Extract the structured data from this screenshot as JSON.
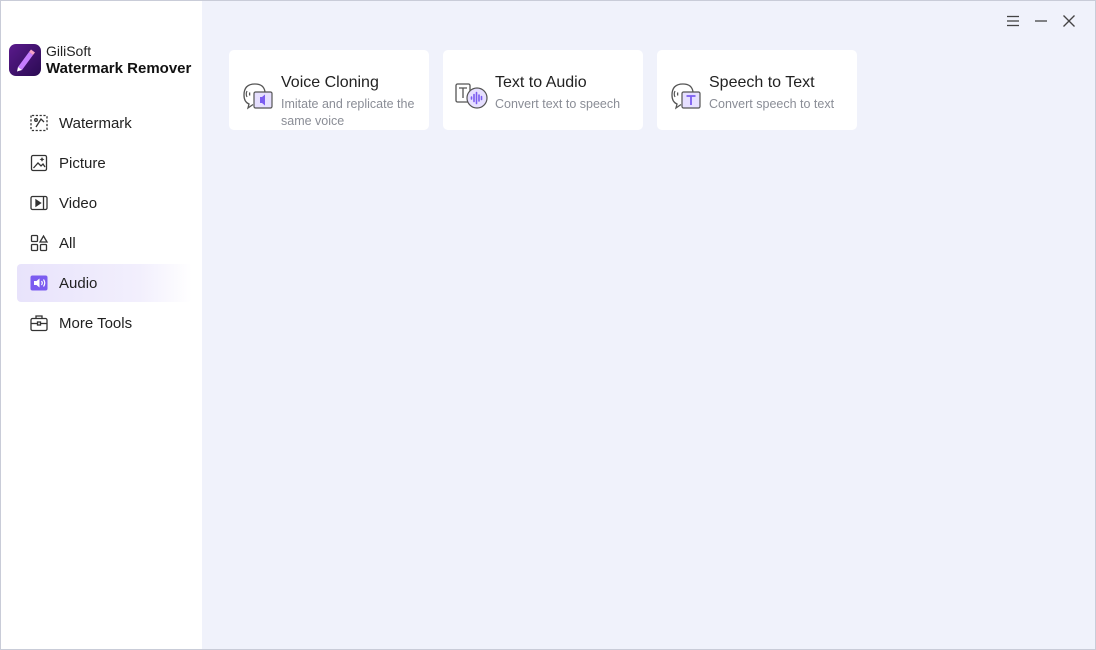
{
  "brand": {
    "line1": "GiliSoft",
    "line2": "Watermark Remover"
  },
  "sidebar": {
    "active": "Audio",
    "items": [
      {
        "label": "Watermark",
        "icon": "watermark-icon"
      },
      {
        "label": "Picture",
        "icon": "picture-icon"
      },
      {
        "label": "Video",
        "icon": "video-icon"
      },
      {
        "label": "All",
        "icon": "all-grid-icon"
      },
      {
        "label": "Audio",
        "icon": "audio-icon"
      },
      {
        "label": "More Tools",
        "icon": "toolbox-icon"
      }
    ]
  },
  "window_controls": {
    "menu": "menu-icon",
    "minimize": "minimize-icon",
    "close": "close-icon"
  },
  "cards": [
    {
      "title": "Voice Cloning",
      "desc": "Imitate and replicate the same voice",
      "icon": "voice-cloning-icon"
    },
    {
      "title": "Text to Audio",
      "desc": "Convert text to speech",
      "icon": "text-to-audio-icon"
    },
    {
      "title": "Speech to Text",
      "desc": "Convert speech to text",
      "icon": "speech-to-text-icon"
    }
  ],
  "colors": {
    "accent": "#7b5cf0",
    "content_bg": "#f0f2fb",
    "sidebar_bg": "#ffffff",
    "logo_bg": "#3d1270"
  }
}
